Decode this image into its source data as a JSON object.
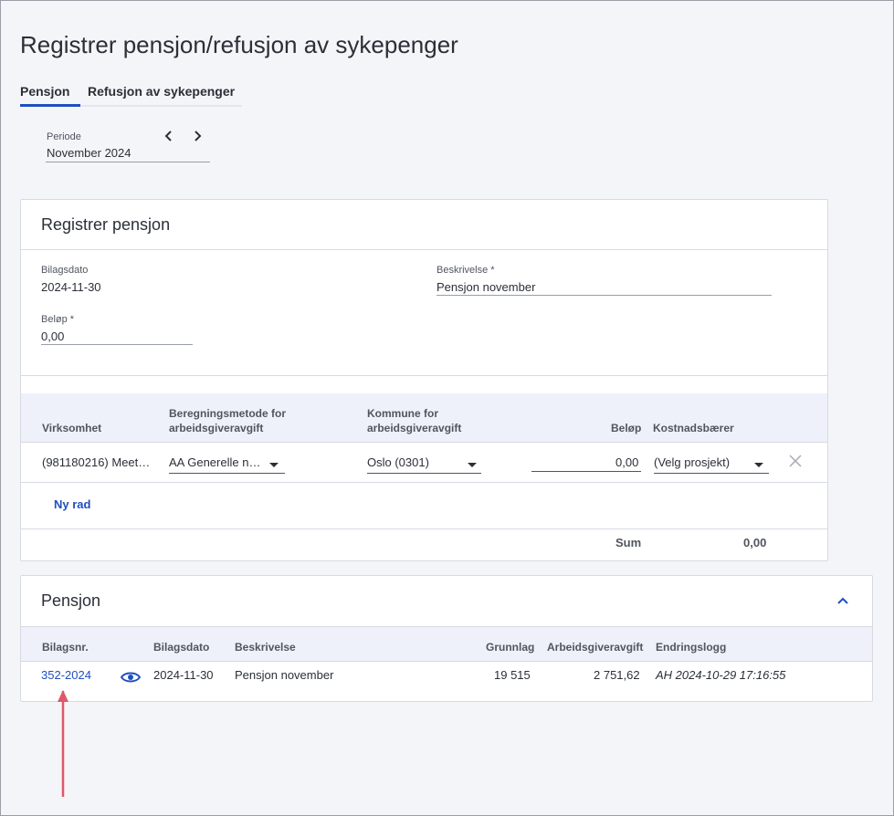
{
  "page": {
    "title": "Registrer pensjon/refusjon av sykepenger"
  },
  "tabs": [
    {
      "label": "Pensjon",
      "active": true
    },
    {
      "label": "Refusjon av sykepenger",
      "active": false
    }
  ],
  "period": {
    "label": "Periode",
    "value": "November 2024"
  },
  "register": {
    "title": "Registrer pensjon",
    "bilagsdato_label": "Bilagsdato",
    "bilagsdato_value": "2024-11-30",
    "beskrivelse_label": "Beskrivelse *",
    "beskrivelse_value": "Pensjon november",
    "belop_label": "Beløp *",
    "belop_value": "0,00",
    "table": {
      "headers": {
        "virksomhet": "Virksomhet",
        "beregning_1": "Beregningsmetode for",
        "beregning_2": "arbeidsgiveravgift",
        "kommune_1": "Kommune for",
        "kommune_2": "arbeidsgiveravgift",
        "belop": "Beløp",
        "kostnadsbaerer": "Kostnadsbærer"
      },
      "row": {
        "virksomhet": "(981180216) Meet…",
        "beregning": "AA Generelle n…",
        "kommune": "Oslo (0301)",
        "belop": "0,00",
        "kostnadsbaerer": "(Velg prosjekt)"
      },
      "add_row": "Ny rad",
      "sum_label": "Sum",
      "sum_value": "0,00"
    }
  },
  "pensjon": {
    "title": "Pensjon",
    "headers": {
      "bilagsnr": "Bilagsnr.",
      "bilagsdato": "Bilagsdato",
      "beskrivelse": "Beskrivelse",
      "grunnlag": "Grunnlag",
      "arbeidsgiveravgift": "Arbeidsgiveravgift",
      "endringslogg": "Endringslogg"
    },
    "rows": [
      {
        "bilagsnr": "352-2024",
        "bilagsdato": "2024-11-30",
        "beskrivelse": "Pensjon november",
        "grunnlag": "19 515",
        "arbeidsgiveravgift": "2 751,62",
        "endringslogg": "AH 2024-10-29 17:16:55"
      }
    ]
  },
  "colors": {
    "accent": "#1f4fbf",
    "annotation_arrow": "#e0566a"
  }
}
